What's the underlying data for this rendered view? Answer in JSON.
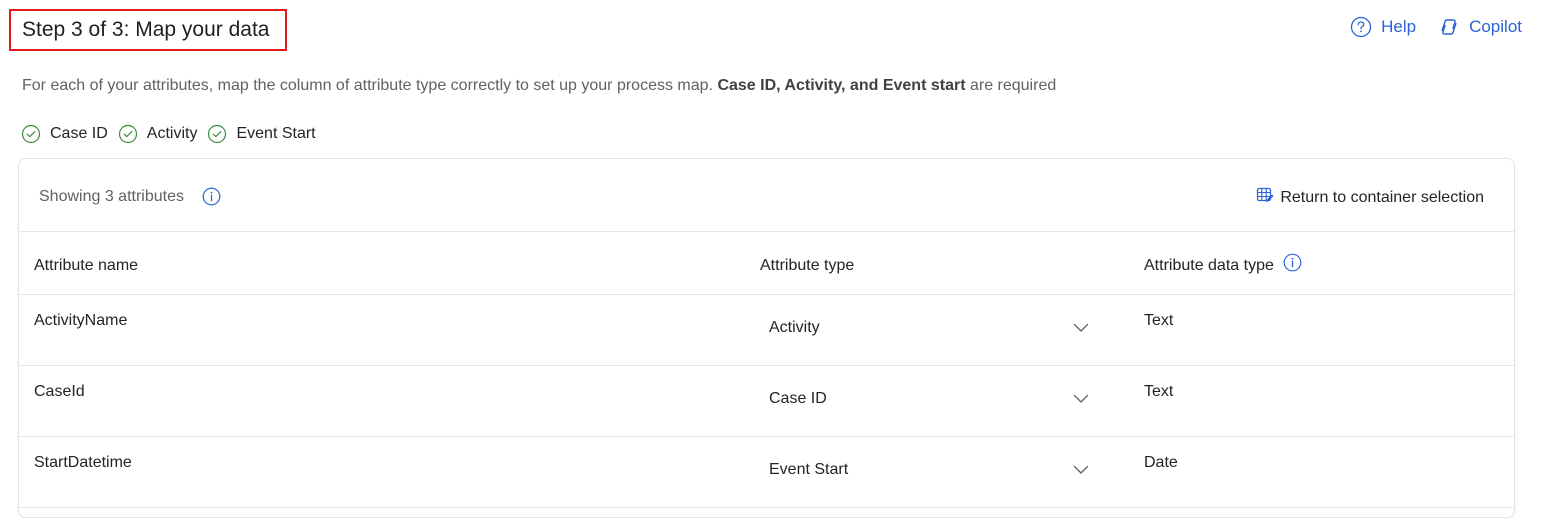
{
  "header": {
    "title": "Step 3 of 3: Map your data",
    "help_label": "Help",
    "copilot_label": "Copilot"
  },
  "description": {
    "text": "For each of your attributes, map the column of attribute type correctly to set up your process map. ",
    "bold": "Case ID, Activity, and Event start",
    "suffix": " are required"
  },
  "required": [
    "Case ID",
    "Activity",
    "Event Start"
  ],
  "card": {
    "showing_label": "Showing 3 attributes",
    "return_label": "Return to container selection"
  },
  "table": {
    "headers": {
      "name": "Attribute name",
      "type": "Attribute type",
      "data_type": "Attribute data type"
    },
    "rows": [
      {
        "name": "ActivityName",
        "type": "Activity",
        "data_type": "Text"
      },
      {
        "name": "CaseId",
        "type": "Case ID",
        "data_type": "Text"
      },
      {
        "name": "StartDatetime",
        "type": "Event Start",
        "data_type": "Date"
      }
    ]
  },
  "colors": {
    "accent": "#2b63d9",
    "success": "#3d8b40",
    "highlight": "#e01b1b"
  }
}
